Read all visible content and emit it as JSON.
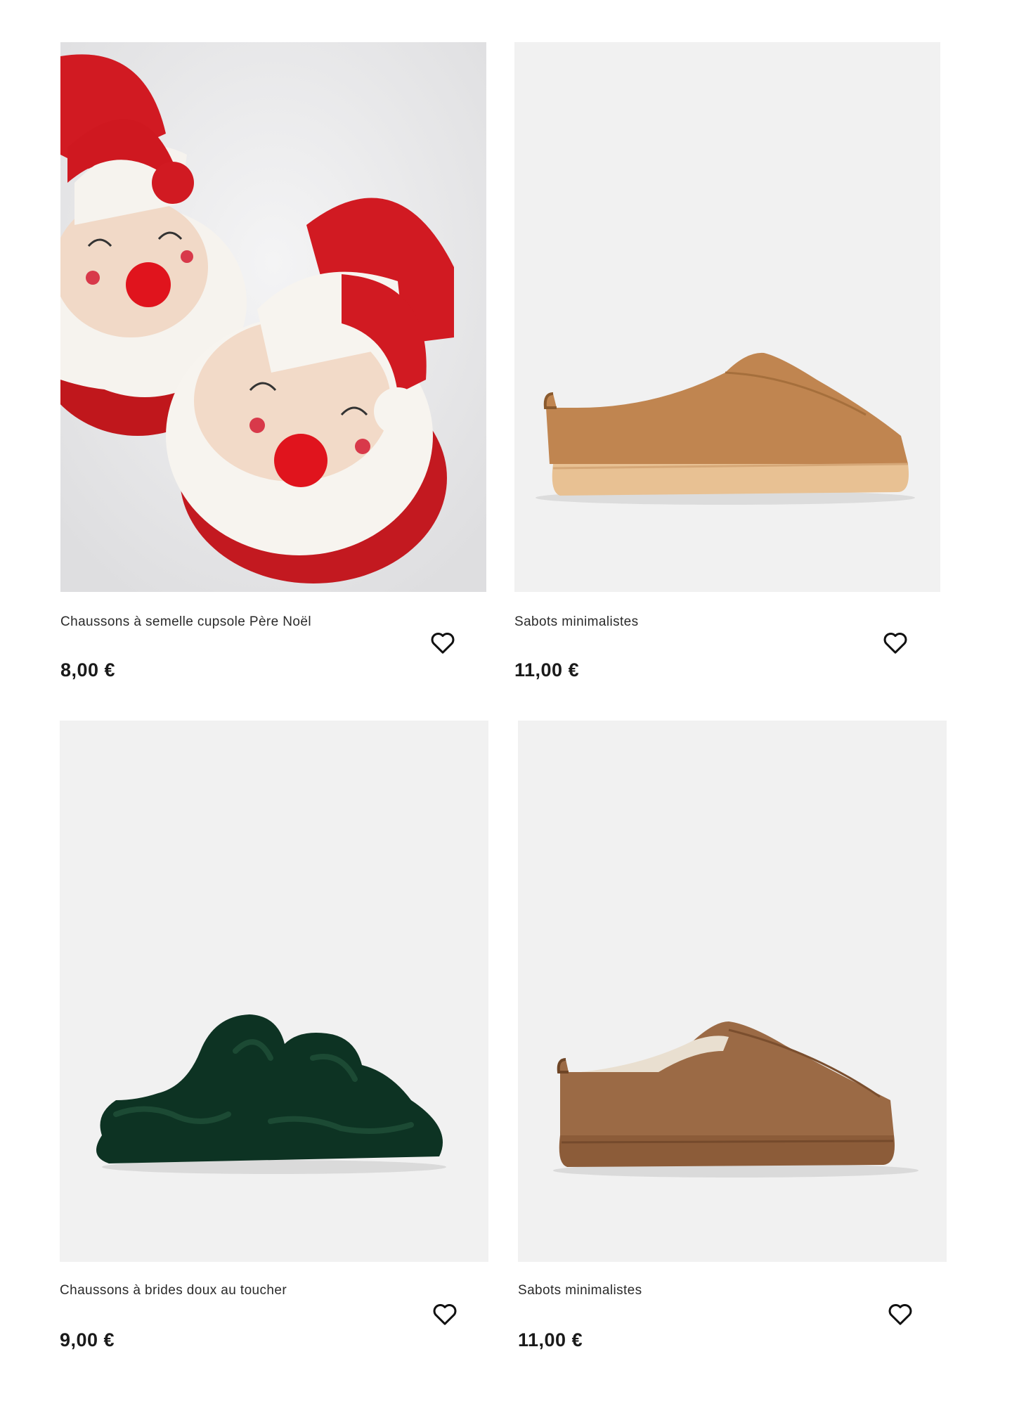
{
  "products": [
    {
      "name": "Chaussons à semelle cupsole Père Noël",
      "price": "8,00 €",
      "image_icon": "santa-slippers-photo",
      "wishlist_icon": "heart-outline-icon"
    },
    {
      "name": "Sabots minimalistes",
      "price": "11,00 €",
      "image_icon": "tan-suede-clog-photo",
      "wishlist_icon": "heart-outline-icon"
    },
    {
      "name": "Chaussons à brides doux au toucher",
      "price": "9,00 €",
      "image_icon": "green-fur-slide-photo",
      "wishlist_icon": "heart-outline-icon"
    },
    {
      "name": "Sabots minimalistes",
      "price": "11,00 €",
      "image_icon": "brown-suede-clog-photo",
      "wishlist_icon": "heart-outline-icon"
    }
  ],
  "colors": {
    "image_background": "#f1f1f1",
    "text": "#1a1a1a"
  }
}
